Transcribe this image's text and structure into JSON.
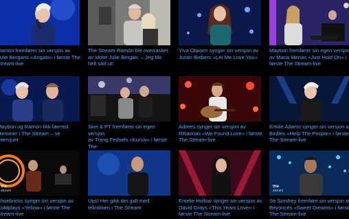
{
  "videos": [
    {
      "caption": "Ramón fremfører sin versjon av\nJulie Bergans «Arigato» i første The\nStream-live"
    },
    {
      "caption": "The Stream-Ramón ble overrasket\nav idolet Julie Bergan: – Jeg blir\nhelt satt ut!"
    },
    {
      "caption": "Ylva Olaisen synger sin versjon av\nJustin Biebers «Let Me Love You»"
    },
    {
      "caption": "Maybon fremfører sin egen versjon\nav Maria Menas «Just Hold On» i\nførste The Stream-live"
    },
    {
      "caption": "Maybon og Ramón fikk færrest\nstemmer i The Stream – se intervjuet"
    },
    {
      "caption": "Skei & PT fremfører sin egen versjon\nav Trang Fedsels «Kursiv» i første The\nStream-live"
    },
    {
      "caption": "Adrees synger sin versjon av\nRihannas «We Found Love» i første\nThe Stream-live"
    },
    {
      "caption": "Emilie Adams synger sin versjon av\nBirdies «Help The People» i første\nThe Stream-live"
    },
    {
      "caption": "Shoebricks synger sin versjon av\nColdplays «Yellow» i første The\nStream-live"
    },
    {
      "caption": "Ups! Her gikk det galt med\nteknikken i The Stream"
    },
    {
      "caption": "Emelie Hollow synger sin versjon av\nDavid Grays «This Years Love» i\nførste The Stream-live"
    },
    {
      "caption": "Se Sondrey fremføre sin versjon av\nBeyoncés «Sweet Dreams» i første\nThe Stream-live"
    }
  ],
  "watermark": {
    "line1": "the",
    "line2": "stream"
  },
  "colors": {
    "background": "#000000",
    "caption": "#4aa6ff"
  }
}
